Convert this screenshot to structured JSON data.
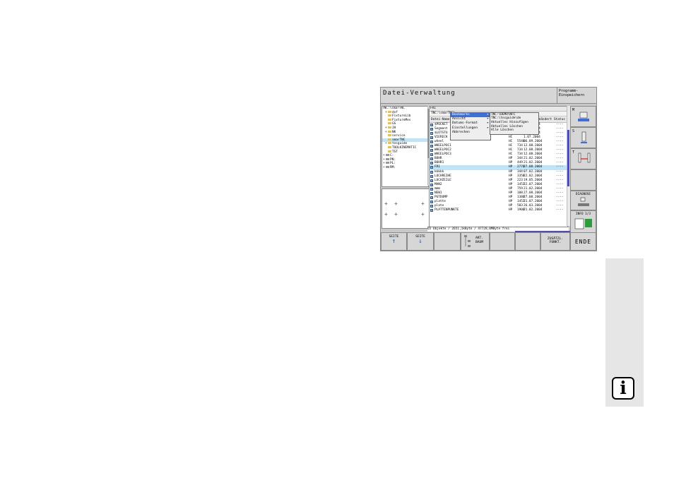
{
  "window": {
    "title": "Datei-Verwaltung",
    "mode_line1": "Programm-",
    "mode_line2": "Einspeichern"
  },
  "tree": {
    "header": "TNC:\\smarTNC",
    "items": [
      {
        "label": "dxf",
        "expand": "+"
      },
      {
        "label": "FixtureLib",
        "expand": ""
      },
      {
        "label": "FixtureMes",
        "expand": ""
      },
      {
        "label": "GS",
        "expand": ""
      },
      {
        "label": "JH",
        "expand": "+"
      },
      {
        "label": "NK",
        "expand": "+"
      },
      {
        "label": "service",
        "expand": ""
      },
      {
        "label": "smarTNC",
        "expand": ""
      },
      {
        "label": "tncguide",
        "expand": "+"
      },
      {
        "label": "TOOLKINEMATIC",
        "expand": ""
      },
      {
        "label": "TST",
        "expand": ""
      },
      {
        "label": "C:",
        "expand": "+"
      },
      {
        "label": "PN:",
        "expand": "+"
      },
      {
        "label": "PL:",
        "expand": "+"
      },
      {
        "label": "RM:",
        "expand": "+"
      }
    ]
  },
  "filelist": {
    "header": "FR1",
    "path": "TNC:\\smarTNC\\",
    "columns": {
      "name": "Datei-Name",
      "type": "Typ",
      "size": "Größe",
      "changed": "Geändert",
      "status": "Status"
    },
    "files": [
      {
        "name": "$POCKET",
        "type": "HP",
        "size": "",
        "date": "1.05.2004",
        "status": "----"
      },
      {
        "name": "Segment",
        "type": "HP",
        "size": "",
        "date": "7.07.2004",
        "status": "----"
      },
      {
        "name": "$LOTSTU",
        "type": "HP",
        "size": "",
        "date": "9.08.2004",
        "status": "----"
      },
      {
        "name": "VIERECK",
        "type": "HC",
        "size": "",
        "date": "1.07.2004",
        "status": "----"
      },
      {
        "name": "wheel",
        "type": "HC",
        "size": "5540",
        "date": "06.09.2004",
        "status": "----"
      },
      {
        "name": "WHEELPOC1",
        "type": "HC",
        "size": "734",
        "date": "12.08.2004",
        "status": "----"
      },
      {
        "name": "WHEELPOC2",
        "type": "HC",
        "size": "734",
        "date": "12.08.2004",
        "status": "----"
      },
      {
        "name": "WHEELPOC3",
        "type": "HC",
        "size": "734",
        "date": "12.08.2004",
        "status": "----"
      },
      {
        "name": "BOHR",
        "type": "HP",
        "size": "344",
        "date": "21.02.2004",
        "status": "----"
      },
      {
        "name": "BOHR1",
        "type": "HP",
        "size": "449",
        "date": "21.02.2004",
        "status": "----"
      },
      {
        "name": "FR1",
        "type": "HP",
        "size": "2770",
        "date": "27.08.2004",
        "status": "----"
      },
      {
        "name": "kkkkk",
        "type": "HP",
        "size": "344",
        "date": "07.02.2004",
        "status": "----"
      },
      {
        "name": "LOCHREIHE",
        "type": "HP",
        "size": "3358",
        "date": "22.02.2004",
        "status": "----"
      },
      {
        "name": "LOCHZEILE",
        "type": "HP",
        "size": "223",
        "date": "19.05.2004",
        "status": "----"
      },
      {
        "name": "MAN2",
        "type": "HP",
        "size": "1453",
        "date": "22.07.2004",
        "status": "----"
      },
      {
        "name": "mmm",
        "type": "HP",
        "size": "759",
        "date": "21.02.2004",
        "status": "----"
      },
      {
        "name": "NEW1",
        "type": "HP",
        "size": "108",
        "date": "27.08.2004",
        "status": "----"
      },
      {
        "name": "PGTDUMP",
        "type": "HP",
        "size": "1380",
        "date": "27.08.2004",
        "status": "----"
      },
      {
        "name": "platte",
        "type": "HP",
        "size": "1453",
        "date": "21.07.2004",
        "status": "----"
      },
      {
        "name": "plate",
        "type": "HP",
        "size": "583",
        "date": "26.03.2004",
        "status": "----"
      },
      {
        "name": "PLATTENPUNKTE",
        "type": "HP",
        "size": "1900",
        "date": "21.02.2004",
        "status": "----"
      }
    ],
    "status_text": "65 Objekte / 2651,1kByte / 47728,0MByte frei"
  },
  "context_menu": {
    "items": [
      {
        "label": "Bookmarks",
        "arrow": "▸"
      },
      {
        "label": "Ansicht",
        "arrow": "▸"
      },
      {
        "label": "Datums-Format",
        "arrow": "▸"
      },
      {
        "label": "Einstellungen",
        "arrow": "▸"
      },
      {
        "label": "Abbrechen",
        "arrow": ""
      }
    ],
    "submenu": [
      "TNC:\\DEMO\\NFC",
      "TNC:\\tncguide\\de",
      "Aktuelles Hinzufügen",
      "Aktuelles Löschen",
      "Alle Löschen"
    ]
  },
  "sidekeys": {
    "m": "M",
    "s": "S",
    "t": "T",
    "diagnose": "DIAGNOSE",
    "info": "INFO 1/3"
  },
  "softkeys": {
    "page_up_line1": "SEITE",
    "page_down_line1": "SEITE",
    "tree_line1": "AKT.",
    "tree_line2": "BAUM",
    "extra_line1": "ZUSÄTZL.",
    "extra_line2": "FUNKT.",
    "end": "ENDE"
  },
  "page": {
    "info_glyph": "i"
  }
}
